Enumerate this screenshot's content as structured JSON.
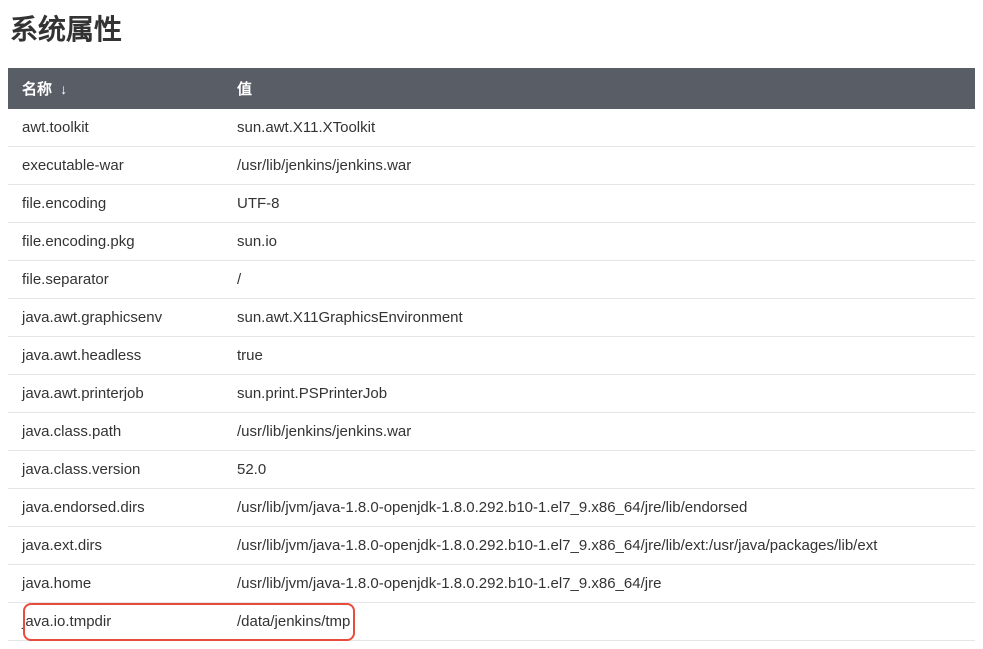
{
  "page": {
    "title": "系统属性"
  },
  "table": {
    "headers": {
      "name": "名称",
      "value": "值",
      "sort_indicator": "↓"
    },
    "rows": [
      {
        "name": "awt.toolkit",
        "value": "sun.awt.X11.XToolkit"
      },
      {
        "name": "executable-war",
        "value": "/usr/lib/jenkins/jenkins.war"
      },
      {
        "name": "file.encoding",
        "value": "UTF-8"
      },
      {
        "name": "file.encoding.pkg",
        "value": "sun.io"
      },
      {
        "name": "file.separator",
        "value": "/"
      },
      {
        "name": "java.awt.graphicsenv",
        "value": "sun.awt.X11GraphicsEnvironment"
      },
      {
        "name": "java.awt.headless",
        "value": "true"
      },
      {
        "name": "java.awt.printerjob",
        "value": "sun.print.PSPrinterJob"
      },
      {
        "name": "java.class.path",
        "value": "/usr/lib/jenkins/jenkins.war"
      },
      {
        "name": "java.class.version",
        "value": "52.0"
      },
      {
        "name": "java.endorsed.dirs",
        "value": "/usr/lib/jvm/java-1.8.0-openjdk-1.8.0.292.b10-1.el7_9.x86_64/jre/lib/endorsed"
      },
      {
        "name": "java.ext.dirs",
        "value": "/usr/lib/jvm/java-1.8.0-openjdk-1.8.0.292.b10-1.el7_9.x86_64/jre/lib/ext:/usr/java/packages/lib/ext"
      },
      {
        "name": "java.home",
        "value": "/usr/lib/jvm/java-1.8.0-openjdk-1.8.0.292.b10-1.el7_9.x86_64/jre"
      },
      {
        "name": "java.io.tmpdir",
        "value": "/data/jenkins/tmp"
      }
    ],
    "highlighted_row_index": 13
  }
}
